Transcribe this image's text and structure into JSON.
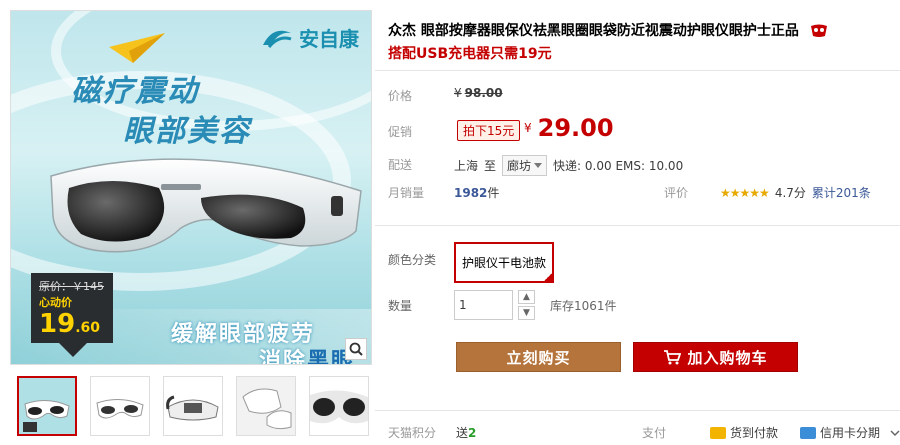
{
  "product": {
    "title": "众杰 眼部按摩器眼保仪祛黑眼圈眼袋防近视震动护眼仪眼护士正品",
    "subtitle": "搭配USB充电器只需19元"
  },
  "gallery": {
    "brand": "安自康",
    "slogan_line1": "磁疗震动",
    "slogan_line2": "眼部美容",
    "tag_original": "原价：￥145",
    "tag_label": "心动价",
    "tag_price_int": "19",
    "tag_price_dec": ".60",
    "slogan_line3": "缓解眼部疲劳",
    "slogan_line4_a": "消除",
    "slogan_line4_b": "黑眼"
  },
  "price": {
    "label": "价格",
    "currency": "¥",
    "original": "98.00"
  },
  "promo": {
    "label": "促销",
    "badge": "拍下15元",
    "currency": "¥",
    "price": "29.00"
  },
  "shipping": {
    "label": "配送",
    "from": "上海",
    "to_word": "至",
    "destination": "廊坊",
    "fee": "快递: 0.00 EMS: 10.00"
  },
  "sales": {
    "label": "月销量",
    "count": "1982",
    "unit": "件"
  },
  "rating": {
    "label": "评价",
    "stars": "★★★★★",
    "score": "4.7分",
    "total": "累计201条"
  },
  "sku": {
    "label": "颜色分类",
    "selected": "护眼仪干电池款"
  },
  "quantity": {
    "label": "数量",
    "value": "1",
    "up": "▲",
    "down": "▼",
    "stock": "库存1061件"
  },
  "actions": {
    "buy_now": "立刻购买",
    "add_to_cart": "加入购物车"
  },
  "footer": {
    "points_label": "天猫积分",
    "points_prefix": "送",
    "points_value": "2",
    "pay_label": "支付",
    "cod": "货到付款",
    "credit": "信用卡分期"
  }
}
